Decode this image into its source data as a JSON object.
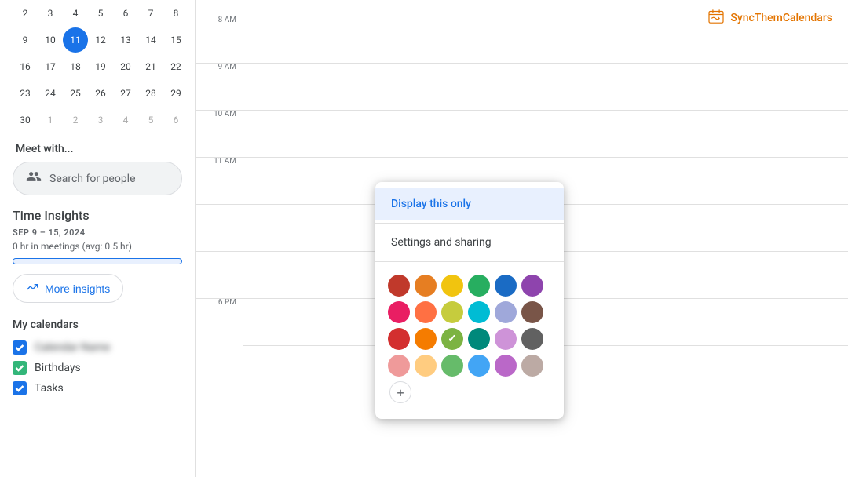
{
  "sidebar": {
    "calendar": {
      "rows": [
        [
          "2",
          "3",
          "4",
          "5",
          "6",
          "7",
          "8"
        ],
        [
          "9",
          "10",
          "11",
          "12",
          "13",
          "14",
          "15"
        ],
        [
          "16",
          "17",
          "18",
          "19",
          "20",
          "21",
          "22"
        ],
        [
          "23",
          "24",
          "25",
          "26",
          "27",
          "28",
          "29"
        ],
        [
          "30",
          "1",
          "2",
          "3",
          "4",
          "5",
          "6"
        ]
      ],
      "today_date": "11"
    },
    "meet_with": {
      "label": "Meet with...",
      "search_placeholder": "Search for people"
    },
    "time_insights": {
      "title": "Time Insights",
      "date_range": "SEP 9 – 15, 2024",
      "meetings_text": "0 hr in meetings (avg: 0.5 hr)",
      "more_insights_label": "More insights"
    },
    "my_calendars": {
      "title": "My calendars",
      "items": [
        {
          "name": "Calendar Name Blurred",
          "color": "blue",
          "blurred": true
        },
        {
          "name": "Birthdays",
          "color": "green",
          "blurred": false
        },
        {
          "name": "Tasks",
          "color": "blue",
          "blurred": false
        }
      ]
    }
  },
  "main": {
    "time_slots": [
      "8 AM",
      "9 AM",
      "10 AM",
      "11 AM",
      "",
      "",
      "6 PM"
    ],
    "branding": {
      "icon": "📅",
      "text": "SyncThemCalendars"
    }
  },
  "dropdown": {
    "display_only_label": "Display this only",
    "settings_sharing_label": "Settings and sharing",
    "colors": [
      [
        "#c0392b",
        "#e67e22",
        "#f1c40f",
        "#27ae60",
        "#2980b9",
        "#8e44ad"
      ],
      [
        "#e91e63",
        "#ff7043",
        "#afb42b",
        "#00bcd4",
        "#9fa8da",
        "#795548"
      ],
      [
        "#d32f2f",
        "#f57c00",
        "#7cb342",
        "#00897b",
        "#ce93d8",
        "#616161"
      ],
      [
        "#ef9a9a",
        "#ffcc80",
        "#66bb6a",
        "#42a5f5",
        "#ba68c8",
        "#bcaaa4"
      ]
    ],
    "selected_color": "#7cb342",
    "add_label": "+"
  }
}
